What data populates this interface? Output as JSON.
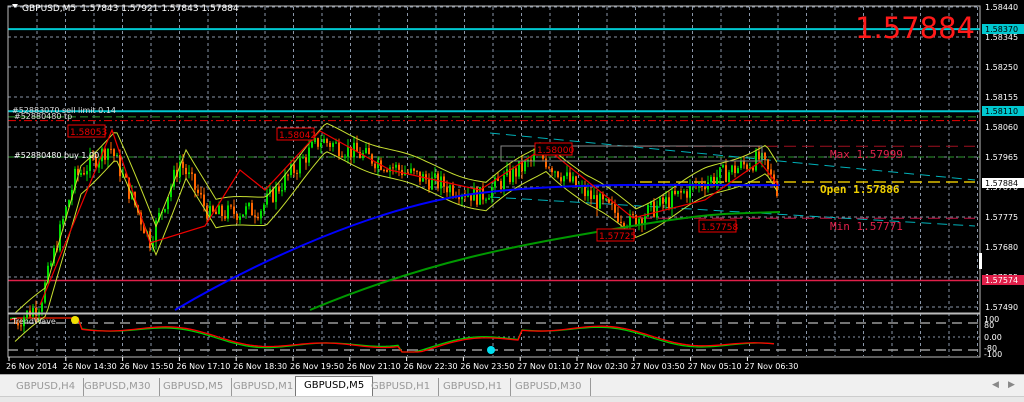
{
  "header": {
    "symbol": "GBPUSD,M5",
    "ohlc": "1.57843 1.57921 1.57843 1.57884"
  },
  "bid_big": "1.57884",
  "price_axis": [
    "1.58440",
    "1.58345",
    "1.58250",
    "1.58155",
    "1.58060",
    "1.57965",
    "1.57870",
    "1.57775",
    "1.57680",
    "1.57585",
    "1.57490"
  ],
  "price_tags": {
    "cyan_top": "1.58370",
    "cyan_order": "1.58110",
    "bid": "1.57884",
    "red_line": "1.57574"
  },
  "orders": {
    "sell_limit": "#52883070 sell limit 0.14",
    "tp": "#52880480 tp",
    "buy": "#52880480 buy 1.00"
  },
  "zigzag_labels": [
    "1.58053",
    "1.58042",
    "1.58000",
    "1.57725",
    "1.57758"
  ],
  "levels": {
    "max": "Max 1.57999",
    "open": "Open 1.57886",
    "min": "Min 1.57771"
  },
  "indicator": {
    "name": "TrendWave",
    "axis": [
      "100",
      "80",
      "0.00",
      "-80",
      "-100"
    ]
  },
  "time_axis": [
    "26 Nov 2014",
    "26 Nov 14:30",
    "26 Nov 15:50",
    "26 Nov 17:10",
    "26 Nov 18:30",
    "26 Nov 19:50",
    "26 Nov 21:10",
    "26 Nov 22:30",
    "26 Nov 23:50",
    "27 Nov 01:10",
    "27 Nov 02:30",
    "27 Nov 03:50",
    "27 Nov 05:10",
    "27 Nov 06:30"
  ],
  "tabs": [
    {
      "label": "GBPUSD,H4"
    },
    {
      "label": "GBPUSD,M30"
    },
    {
      "label": "GBPUSD,M5"
    },
    {
      "label": "GBPUSD,M1"
    },
    {
      "label": "GBPUSD,M5",
      "active": true
    },
    {
      "label": "GBPUSD,H1"
    },
    {
      "label": "GBPUSD,H1"
    },
    {
      "label": "GBPUSD,M30"
    }
  ],
  "colors": {
    "bull": "#00dd00",
    "bear": "#ff6600",
    "cyan": "#00c8d0",
    "red": "#e0002a",
    "blue": "#0000ff",
    "ma_green": "#009900",
    "band": "#c8e030"
  }
}
